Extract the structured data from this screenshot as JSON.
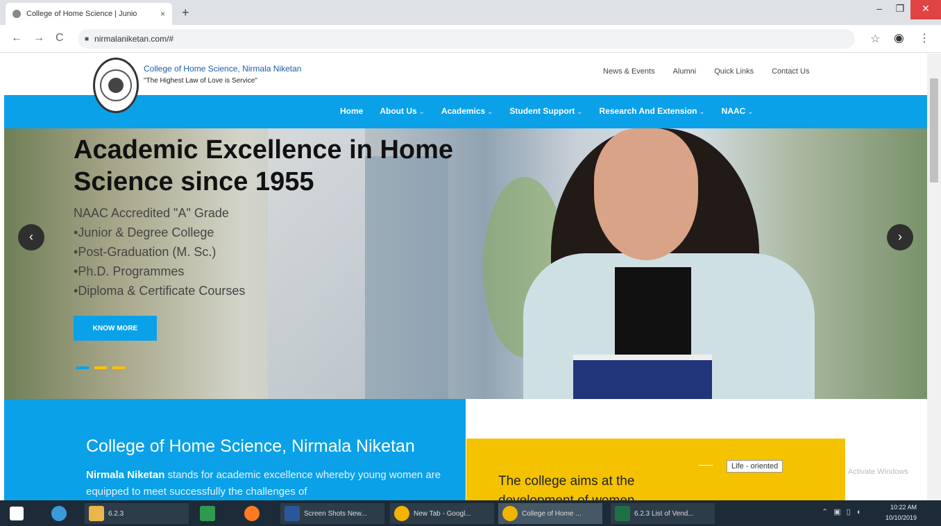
{
  "browser": {
    "tab_title": "College of Home Science | Junio",
    "tab_close": "×",
    "new_tab": "+",
    "url": "nirmalaniketan.com/#",
    "window_controls": [
      "–",
      "❐",
      "✕"
    ],
    "nav_icons": {
      "back": "←",
      "forward": "→",
      "reload": "C"
    }
  },
  "header": {
    "brand_name": "College of Home Science, Nirmala Niketan",
    "motto": "\"The Highest Law of Love is Service\"",
    "top_links": [
      "News & Events",
      "Alumni",
      "Quick Links",
      "Contact Us"
    ]
  },
  "menu": {
    "items": [
      "Home",
      "About Us",
      "Academics",
      "Student Support",
      "Research And Extension",
      "NAAC"
    ]
  },
  "hero": {
    "title": "Academic Excellence in Home Science since 1955",
    "subtitle": "NAAC Accredited \"A\" Grade",
    "list": [
      "Junior & Degree College",
      "Post-Graduation (M. Sc.)",
      "Ph.D. Programmes",
      "Diploma & Certificate Courses"
    ],
    "cta": "KNOW MORE",
    "arrows": {
      "left": "‹",
      "right": "›"
    }
  },
  "about": {
    "title": "College of Home Science, Nirmala Niketan",
    "text_bold": "Nirmala Niketan",
    "text_rest": " stands for academic excellence whereby young women are equipped to meet successfully the challenges of"
  },
  "aims": {
    "text": "The college aims at the development of women",
    "pill": "Life - oriented",
    "watermark": "Activate Windows"
  },
  "taskbar": {
    "items": [
      {
        "label": "6.2.3",
        "color": "#e8b64b"
      },
      {
        "label": "",
        "color": "#2e9a4e"
      },
      {
        "label": "",
        "color": "#ff7b22"
      },
      {
        "label": "Screen Shots New...",
        "color": "#2b579a"
      },
      {
        "label": "New Tab - Googl...",
        "color": "#f2b400"
      },
      {
        "label": "College of Home ...",
        "color": "#f2b400"
      },
      {
        "label": "6.2.3 List of Vend...",
        "color": "#1e7145"
      }
    ],
    "time": "10:22 AM",
    "date": "10/10/2019"
  }
}
